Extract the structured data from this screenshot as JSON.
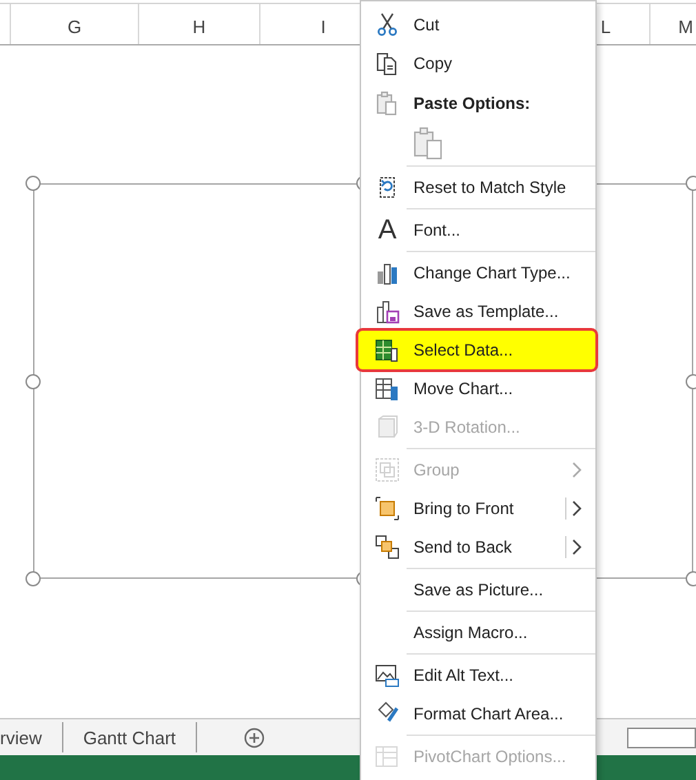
{
  "columns": [
    {},
    {
      "label": "G"
    },
    {
      "label": "H"
    },
    {
      "label": "I"
    },
    {},
    {
      "label": "L"
    },
    {
      "label": "M"
    }
  ],
  "chart": {
    "selected": true
  },
  "sheet_tabs": [
    {
      "label": "rview",
      "selected": false
    },
    {
      "label": "Gantt Chart",
      "selected": false
    }
  ],
  "context_menu": {
    "items": [
      {
        "kind": "item",
        "label": "Cut",
        "disabled": false,
        "selected": false,
        "has_submenu": false,
        "split_button": false
      },
      {
        "kind": "item",
        "label": "Copy",
        "disabled": false,
        "selected": false,
        "has_submenu": false,
        "split_button": false
      },
      {
        "kind": "header",
        "label": "Paste Options:"
      },
      {
        "kind": "paste"
      },
      {
        "kind": "separator"
      },
      {
        "kind": "item",
        "label": "Reset to Match Style",
        "disabled": false,
        "selected": false,
        "has_submenu": false,
        "split_button": false
      },
      {
        "kind": "separator"
      },
      {
        "kind": "item",
        "label": "Font...",
        "glyph": "A",
        "disabled": false,
        "selected": false,
        "has_submenu": false,
        "split_button": false
      },
      {
        "kind": "separator"
      },
      {
        "kind": "item",
        "label": "Change Chart Type...",
        "disabled": false,
        "selected": false,
        "has_submenu": false,
        "split_button": false
      },
      {
        "kind": "item",
        "label": "Save as Template...",
        "disabled": false,
        "selected": false,
        "has_submenu": false,
        "split_button": false
      },
      {
        "kind": "item",
        "label": "Select Data...",
        "disabled": false,
        "selected": true,
        "has_submenu": false,
        "split_button": false
      },
      {
        "kind": "item",
        "label": "Move Chart...",
        "disabled": false,
        "selected": false,
        "has_submenu": false,
        "split_button": false
      },
      {
        "kind": "item",
        "label": "3-D Rotation...",
        "disabled": true,
        "selected": false,
        "has_submenu": false,
        "split_button": false
      },
      {
        "kind": "separator"
      },
      {
        "kind": "item",
        "label": "Group",
        "disabled": true,
        "selected": false,
        "has_submenu": true,
        "split_button": false
      },
      {
        "kind": "item",
        "label": "Bring to Front",
        "disabled": false,
        "selected": false,
        "has_submenu": true,
        "split_button": true
      },
      {
        "kind": "item",
        "label": "Send to Back",
        "disabled": false,
        "selected": false,
        "has_submenu": true,
        "split_button": true
      },
      {
        "kind": "separator"
      },
      {
        "kind": "item",
        "label": "Save as Picture...",
        "disabled": false,
        "selected": false,
        "has_submenu": false,
        "split_button": false
      },
      {
        "kind": "separator"
      },
      {
        "kind": "item",
        "label": "Assign Macro...",
        "disabled": false,
        "selected": false,
        "has_submenu": false,
        "split_button": false
      },
      {
        "kind": "separator"
      },
      {
        "kind": "item",
        "label": "Edit Alt Text...",
        "disabled": false,
        "selected": false,
        "has_submenu": false,
        "split_button": false
      },
      {
        "kind": "item",
        "label": "Format Chart Area...",
        "disabled": false,
        "selected": false,
        "has_submenu": false,
        "split_button": false
      },
      {
        "kind": "separator"
      },
      {
        "kind": "item",
        "label": "PivotChart Options...",
        "disabled": true,
        "selected": false,
        "has_submenu": false,
        "split_button": false
      }
    ]
  }
}
